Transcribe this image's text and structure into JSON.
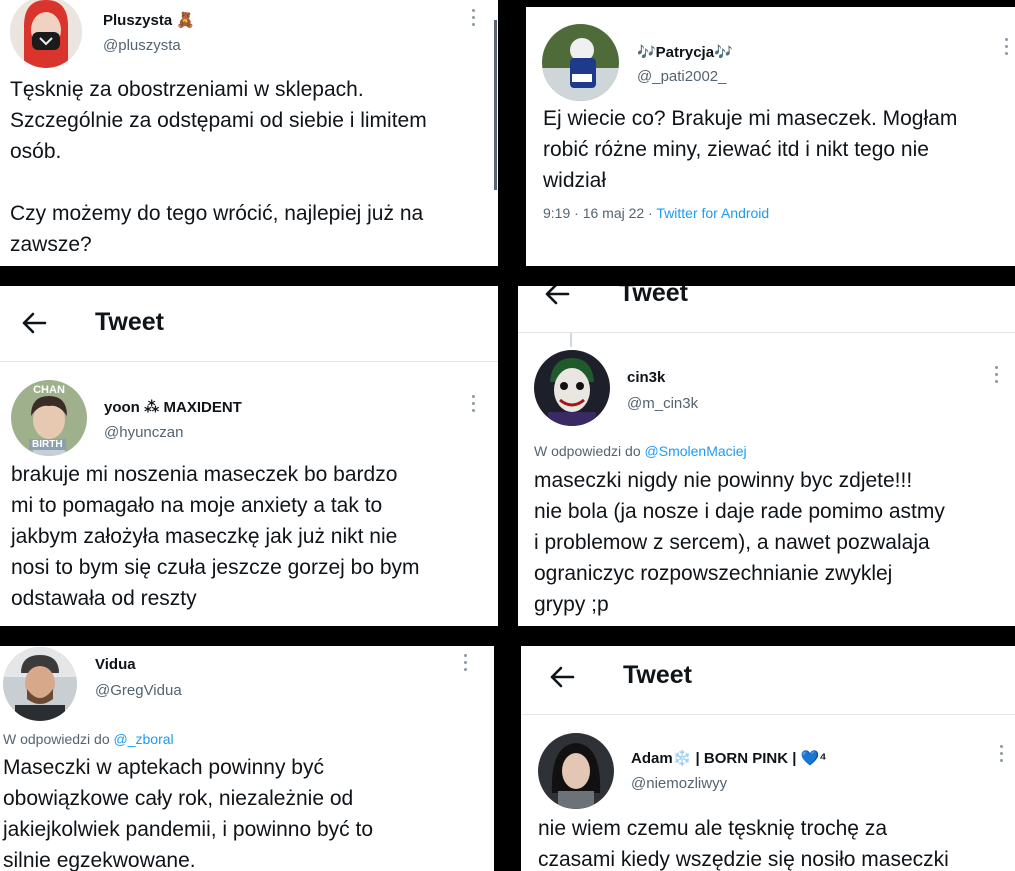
{
  "header": {
    "tweet_title": "Tweet"
  },
  "tweets": [
    {
      "name": "Pluszysta 🧸",
      "handle": "@pluszysta",
      "text": "Tęsknię za obostrzeniami w sklepach.\nSzczególnie za odstępami od siebie i limitem\nosób.\n\nCzy możemy do tego wrócić, najlepiej już na\nzawsze?"
    },
    {
      "name": "🎶Patrycja🎶",
      "handle": "@_pati2002_",
      "text": "Ej wiecie co? Brakuje mi maseczek. Mogłam\nrobić różne miny, ziewać itd i nikt tego nie\nwidział",
      "time": "9:19 · 16 maj 22 · ",
      "source": "Twitter for Android"
    },
    {
      "name": "yoon ⁂ MAXIDENT",
      "handle": "@hyunczan",
      "avatar_top": "CHAN",
      "avatar_bottom": "BIRTH",
      "text": "brakuje mi noszenia maseczek bo bardzo\nmi to pomagało na moje anxiety a tak to\njakbym założyła maseczkę jak już nikt nie\nnosi to bym się czuła jeszcze gorzej bo bym\nodstawała od reszty"
    },
    {
      "name": "cin3k",
      "handle": "@m_cin3k",
      "reply_prefix": "W odpowiedzi do ",
      "reply_to": "@SmolenMaciej",
      "text": "maseczki nigdy nie powinny byc zdjete!!!\nnie bola (ja nosze i daje rade pomimo astmy\ni problemow z sercem), a nawet pozwalaja\nograniczyc rozpowszechnianie zwyklej\ngrypy ;p"
    },
    {
      "name": "Vidua",
      "handle": "@GregVidua",
      "reply_prefix": "W odpowiedzi do ",
      "reply_to": "@_zboral",
      "text": "Maseczki w aptekach powinny być\nobowiązkowe cały rok, niezależnie od\njakiejkolwiek pandemii, i powinno być to\nsilnie egzekwowane."
    },
    {
      "name": "Adam❄️ | BORN PINK | 💙⁴",
      "handle": "@niemozliwyy",
      "text": "nie wiem czemu ale tęsknię trochę za\nczasami kiedy wszędzie się nosiło maseczki"
    }
  ],
  "colors": {
    "link": "#1d9bf0",
    "muted": "#536471",
    "text": "#0f1419",
    "background": "#000000"
  }
}
